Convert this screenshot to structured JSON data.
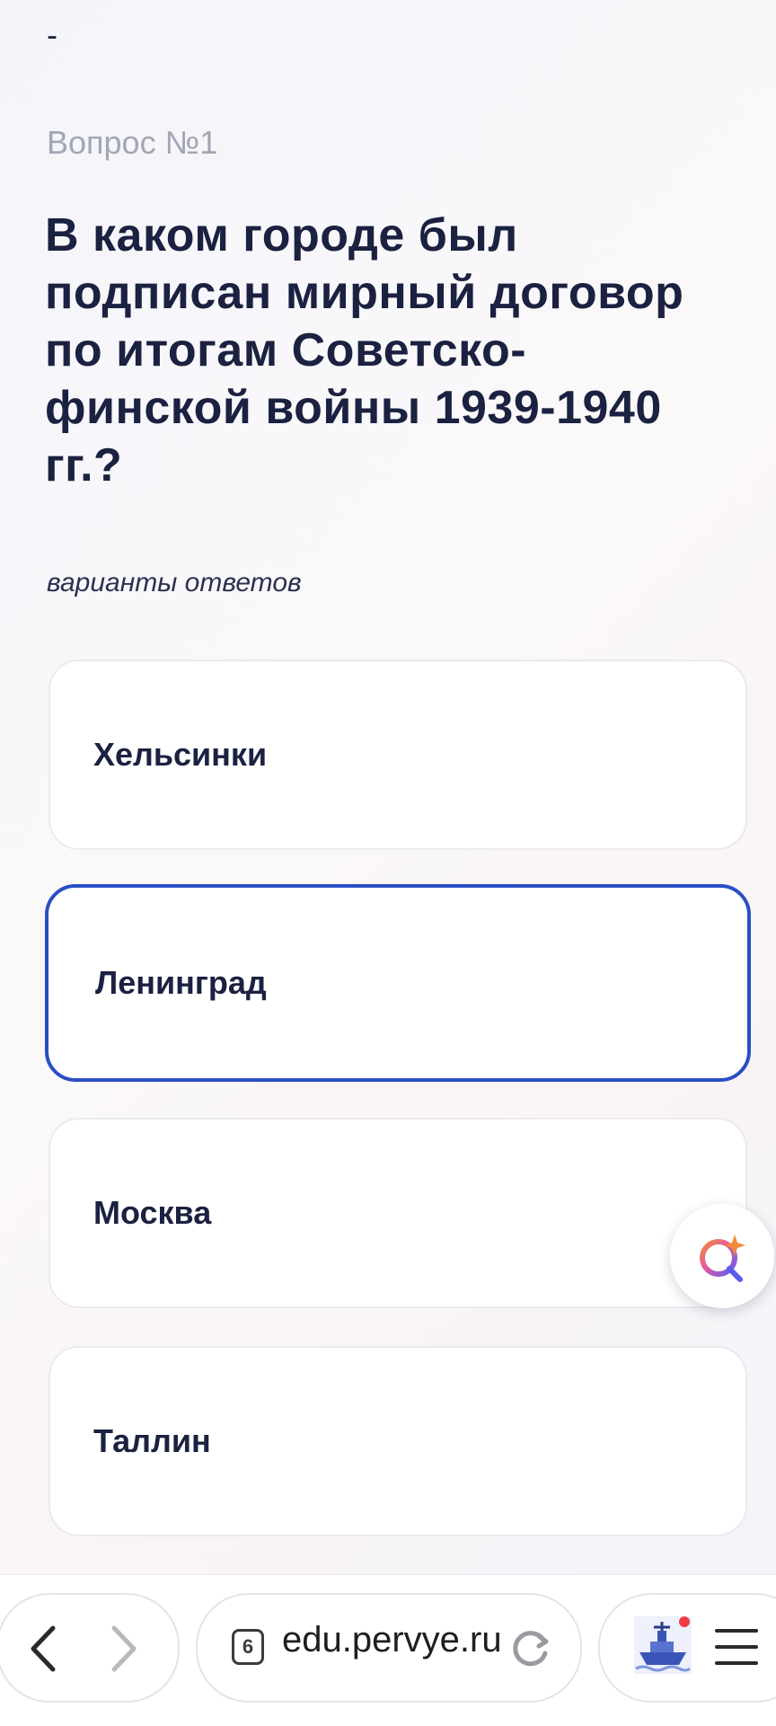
{
  "header": {
    "dash": "-",
    "question_number": "Вопрос №1",
    "question_text": "В каком городе был подписан мирный договор по итогам Советско-финской войны 1939-1940 гг.?"
  },
  "answers": {
    "caption": "варианты ответов",
    "options": [
      {
        "label": "Хельсинки",
        "selected": false
      },
      {
        "label": "Ленинград",
        "selected": true
      },
      {
        "label": "Москва",
        "selected": false
      },
      {
        "label": "Таллин",
        "selected": false
      }
    ]
  },
  "browser": {
    "tab_count": "6",
    "url": "edu.pervye.ru",
    "icons": {
      "back": "chevron-left-icon",
      "forward": "chevron-right-icon",
      "reload": "reload-icon",
      "extension": "ship-icon",
      "menu": "hamburger-menu-icon",
      "assistant": "assistant-icon"
    }
  },
  "colors": {
    "title": "#1b2140",
    "muted": "#a3a6b4",
    "selected_border": "#2a4ec4",
    "notification_dot": "#ee3b45"
  }
}
